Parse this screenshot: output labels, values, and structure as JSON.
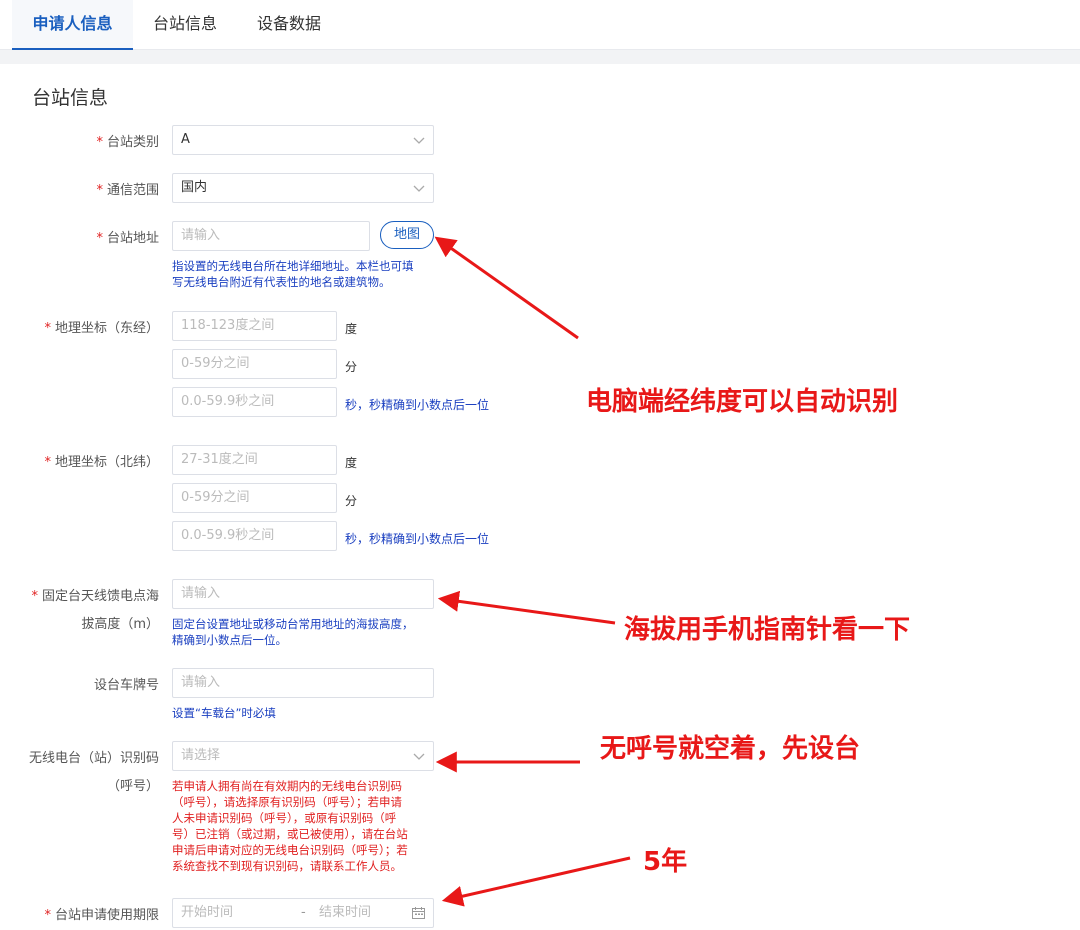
{
  "tabs": [
    "申请人信息",
    "台站信息",
    "设备数据"
  ],
  "section_title": "台站信息",
  "required_mark": "*",
  "fields": {
    "station_type": {
      "label": "台站类别",
      "value": "A"
    },
    "comm_range": {
      "label": "通信范围",
      "value": "国内"
    },
    "address": {
      "label": "台站地址",
      "placeholder": "请输入",
      "map_button": "地图",
      "hint_line1": "指设置的无线电台所在地详细地址。本栏也可填",
      "hint_line2": "写无线电台附近有代表性的地名或建筑物。"
    },
    "longitude": {
      "label": "地理坐标（东经）",
      "deg_placeholder": "118-123度之间",
      "deg_unit": "度",
      "min_placeholder": "0-59分之间",
      "min_unit": "分",
      "sec_placeholder": "0.0-59.9秒之间",
      "sec_unit": "秒，秒精确到小数点后一位"
    },
    "latitude": {
      "label": "地理坐标（北纬）",
      "deg_placeholder": "27-31度之间",
      "deg_unit": "度",
      "min_placeholder": "0-59分之间",
      "min_unit": "分",
      "sec_placeholder": "0.0-59.9秒之间",
      "sec_unit": "秒，秒精确到小数点后一位"
    },
    "altitude": {
      "label_line1": "固定台天线馈电点海",
      "label_line2": "拔高度（m）",
      "placeholder": "请输入",
      "hint_line1": "固定台设置地址或移动台常用地址的海拔高度，",
      "hint_line2": "精确到小数点后一位。"
    },
    "plate": {
      "label": "设台车牌号",
      "placeholder": "请输入",
      "hint": "设置“车载台”时必填"
    },
    "callsign": {
      "label_line1": "无线电台（站）识别码",
      "label_line2": "（呼号）",
      "placeholder": "请选择",
      "hint_lines": [
        "若申请人拥有尚在有效期内的无线电台识别码",
        "（呼号），请选择原有识别码（呼号）；若申请",
        "人未申请识别码（呼号），或原有识别码（呼",
        "号）已注销（或过期，或已被使用），请在台站",
        "申请后申请对应的无线电台识别码（呼号）；若",
        "系统查找不到现有识别码，请联系工作人员。"
      ]
    },
    "period": {
      "label": "台站申请使用期限",
      "start_placeholder": "开始时间",
      "separator": "-",
      "end_placeholder": "结束时间"
    }
  },
  "annotations": {
    "coords": "电脑端经纬度可以自动识别",
    "altitude": "海拔用手机指南针看一下",
    "callsign": "无呼号就空着，先设台",
    "period": "5年"
  },
  "colors": {
    "accent": "#1a5fbf",
    "required": "#e02020",
    "hint_blue": "#1a3fc0",
    "annotation": "#e81818"
  }
}
